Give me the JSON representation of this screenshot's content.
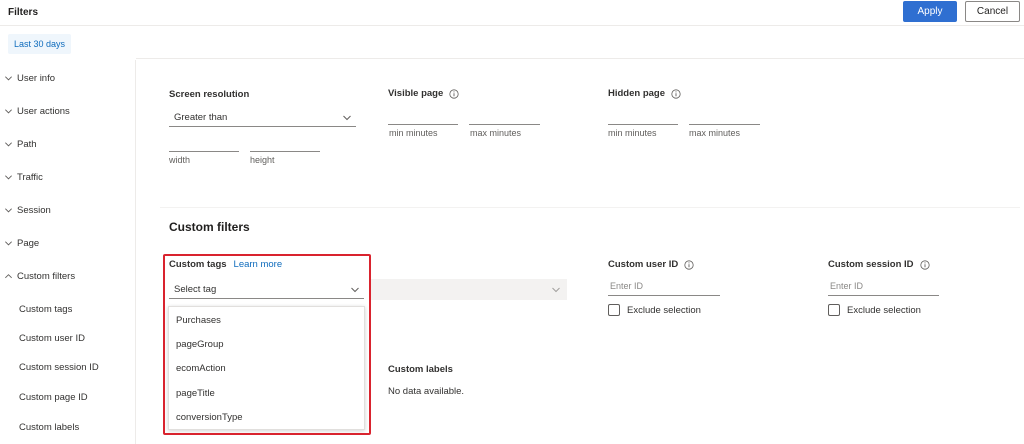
{
  "header": {
    "title": "Filters",
    "apply_label": "Apply",
    "cancel_label": "Cancel"
  },
  "date_range": "Last 30 days",
  "sidebar": {
    "items": [
      {
        "label": "User info",
        "expanded": false
      },
      {
        "label": "User actions",
        "expanded": false
      },
      {
        "label": "Path",
        "expanded": false
      },
      {
        "label": "Traffic",
        "expanded": false
      },
      {
        "label": "Session",
        "expanded": false
      },
      {
        "label": "Page",
        "expanded": false
      },
      {
        "label": "Custom filters",
        "expanded": true
      }
    ],
    "subitems": [
      "Custom tags",
      "Custom user ID",
      "Custom session ID",
      "Custom page ID",
      "Custom labels"
    ]
  },
  "screen_resolution": {
    "label": "Screen resolution",
    "value": "Greater than",
    "width_hint": "width",
    "height_hint": "height"
  },
  "visible_page": {
    "label": "Visible page",
    "min_hint": "min minutes",
    "max_hint": "max minutes"
  },
  "hidden_page": {
    "label": "Hidden page",
    "min_hint": "min minutes",
    "max_hint": "max minutes"
  },
  "custom_filters": {
    "title": "Custom filters",
    "custom_tags": {
      "label": "Custom tags",
      "learn_more": "Learn more",
      "placeholder": "Select tag",
      "options": [
        "Purchases",
        "pageGroup",
        "ecomAction",
        "pageTitle",
        "conversionType"
      ]
    },
    "custom_user_id": {
      "label": "Custom user ID",
      "placeholder": "Enter ID",
      "exclude_label": "Exclude selection"
    },
    "custom_session_id": {
      "label": "Custom session ID",
      "placeholder": "Enter ID",
      "exclude_label": "Exclude selection"
    },
    "custom_labels": {
      "label": "Custom labels",
      "empty_text": "No data available."
    }
  },
  "colors": {
    "accent": "#2f6fd1",
    "highlight": "#d9232e",
    "link": "#0f6cbd"
  }
}
